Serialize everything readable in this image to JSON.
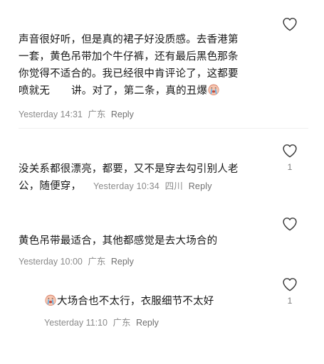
{
  "comments": [
    {
      "lines": [
        "声音很好听，但是真的裙子好没质感。去香港第",
        "一套，黄色吊带加个牛仔裤，还有最后黑色那条",
        "你觉得不适合的。我已经很中肯评论了，这都要",
        "喷就无"
      ],
      "line4_after_gap": "讲。对了，第二条，真的丑爆",
      "emoji": "crying-face-emoji",
      "time": "Yesterday 14:31",
      "location": "广东",
      "reply_label": "Reply",
      "likes": ""
    },
    {
      "line1": "没关系都很漂亮，都要，又不是穿去勾引别人老",
      "line2": "公，随便穿，",
      "time": "Yesterday 10:34",
      "location": "四川",
      "reply_label": "Reply",
      "likes": "1"
    },
    {
      "text": "黄色吊带最适合，其他都感觉是去大场合的",
      "time": "Yesterday 10:00",
      "location": "广东",
      "reply_label": "Reply",
      "likes": ""
    },
    {
      "emoji": "crying-face-emoji",
      "text": "大场合也不太行，衣服细节不太好",
      "time": "Yesterday 11:10",
      "location": "广东",
      "reply_label": "Reply",
      "likes": "1"
    }
  ],
  "colors": {
    "text": "#161616",
    "meta": "#8a8a8a",
    "heart_stroke": "#3a3a3a",
    "divider": "#f0f0f0"
  }
}
